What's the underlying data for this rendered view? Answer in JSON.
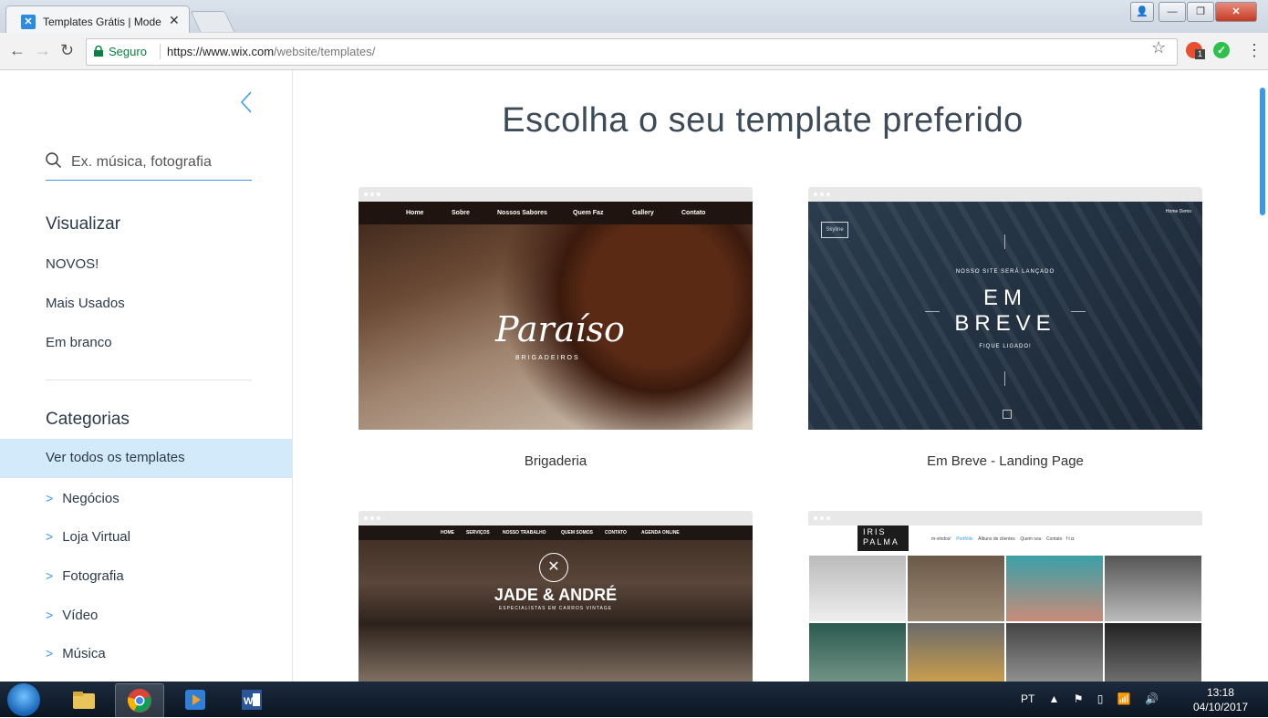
{
  "browser": {
    "tab_title": "Templates Grátis | Model",
    "secure_label": "Seguro",
    "url_host": "https://www.wix.com",
    "url_path": "/website/templates/"
  },
  "sidebar": {
    "search": {
      "placeholder": "Ex. música, fotografia",
      "value": ""
    },
    "visualizar_title": "Visualizar",
    "visualizar_items": [
      "NOVOS!",
      "Mais Usados",
      "Em branco"
    ],
    "categorias_title": "Categorias",
    "active_item": "Ver todos os templates",
    "categories": [
      "Negócios",
      "Loja Virtual",
      "Fotografia",
      "Vídeo",
      "Música"
    ]
  },
  "main": {
    "title": "Escolha o seu template preferido",
    "cards": [
      {
        "label": "Brigaderia",
        "nav": [
          "Home",
          "Sobre",
          "Nossos Sabores",
          "Quem Faz",
          "Gallery",
          "Contato"
        ],
        "logo": "Paraíso",
        "sub": "BRIGADEIROS"
      },
      {
        "label": "Em Breve - Landing Page",
        "logo": "Skyline",
        "nav": "Home  Demo",
        "small_top": "NOSSO SITE SERÁ LANÇADO",
        "big1": "EM",
        "big2": "BREVE",
        "small_bottom": "FIQUE LIGADO!"
      },
      {
        "label": "",
        "nav": [
          "HOME",
          "SERVIÇOS",
          "NOSSO TRABALHO",
          "QUEM SOMOS",
          "CONTATO",
          "AGENDA ONLINE"
        ],
        "title": "JADE & ANDRÉ",
        "sub": "ESPECIALISTAS EM CARROS VINTAGE"
      },
      {
        "label": "",
        "logo1": "IRIS",
        "logo2": "PALMA",
        "nav_items": [
          "m-vindos!",
          "Portfólio",
          "Álbuns de clientes",
          "Quem sou",
          "Contato"
        ],
        "nav_active": "Portfólio"
      }
    ]
  },
  "taskbar": {
    "lang": "PT",
    "time": "13:18",
    "date": "04/10/2017"
  },
  "colors": {
    "accent": "#3899ec",
    "active_bg": "#d3eafb",
    "text": "#2b3a4a"
  }
}
